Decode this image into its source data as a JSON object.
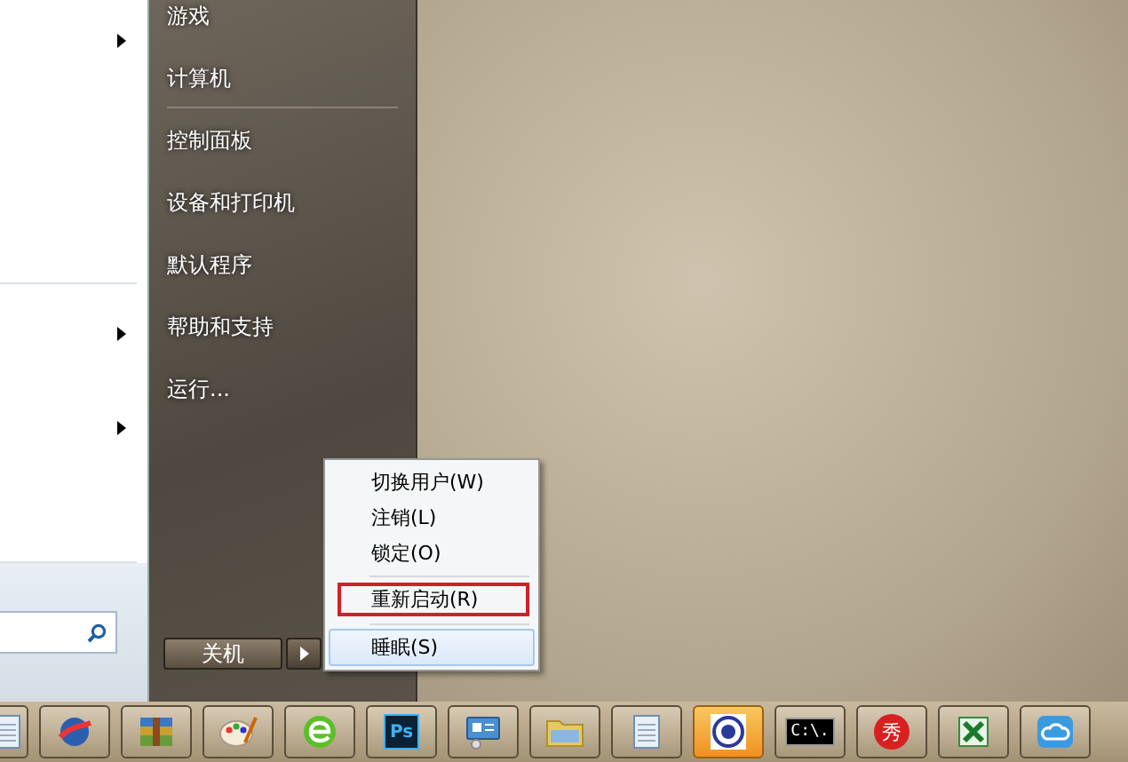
{
  "start_menu": {
    "right_items": [
      {
        "label": "游戏",
        "separator_after": false
      },
      {
        "label": "计算机",
        "separator_after": true
      },
      {
        "label": "控制面板",
        "separator_after": false
      },
      {
        "label": "设备和打印机",
        "separator_after": false
      },
      {
        "label": "默认程序",
        "separator_after": false
      },
      {
        "label": "帮助和支持",
        "separator_after": false
      },
      {
        "label": "运行...",
        "separator_after": false
      }
    ],
    "shutdown_button": {
      "label": "关机"
    }
  },
  "power_menu": {
    "items": [
      {
        "label": "切换用户(W)",
        "selected": false,
        "separator_before": false,
        "outlined": false
      },
      {
        "label": "注销(L)",
        "selected": false,
        "separator_before": false,
        "outlined": false
      },
      {
        "label": "锁定(O)",
        "selected": false,
        "separator_before": false,
        "outlined": false
      },
      {
        "label": "重新启动(R)",
        "selected": false,
        "separator_before": true,
        "outlined": true
      },
      {
        "label": "睡眠(S)",
        "selected": true,
        "separator_before": true,
        "outlined": false
      }
    ]
  },
  "taskbar": {
    "buttons": [
      {
        "kind": "notepad",
        "selected": false,
        "partial": true
      },
      {
        "kind": "globe",
        "selected": false
      },
      {
        "kind": "archive",
        "selected": false
      },
      {
        "kind": "palette",
        "selected": false
      },
      {
        "kind": "browser",
        "selected": false
      },
      {
        "kind": "ps",
        "selected": false,
        "label": "Ps"
      },
      {
        "kind": "remote",
        "selected": false
      },
      {
        "kind": "folder",
        "selected": false
      },
      {
        "kind": "notepad",
        "selected": false
      },
      {
        "kind": "badge",
        "selected": true
      },
      {
        "kind": "cmd",
        "selected": false,
        "label": "C:\\."
      },
      {
        "kind": "red",
        "selected": false,
        "label": "秀"
      },
      {
        "kind": "excel",
        "selected": false
      },
      {
        "kind": "cloud",
        "selected": false
      }
    ]
  }
}
